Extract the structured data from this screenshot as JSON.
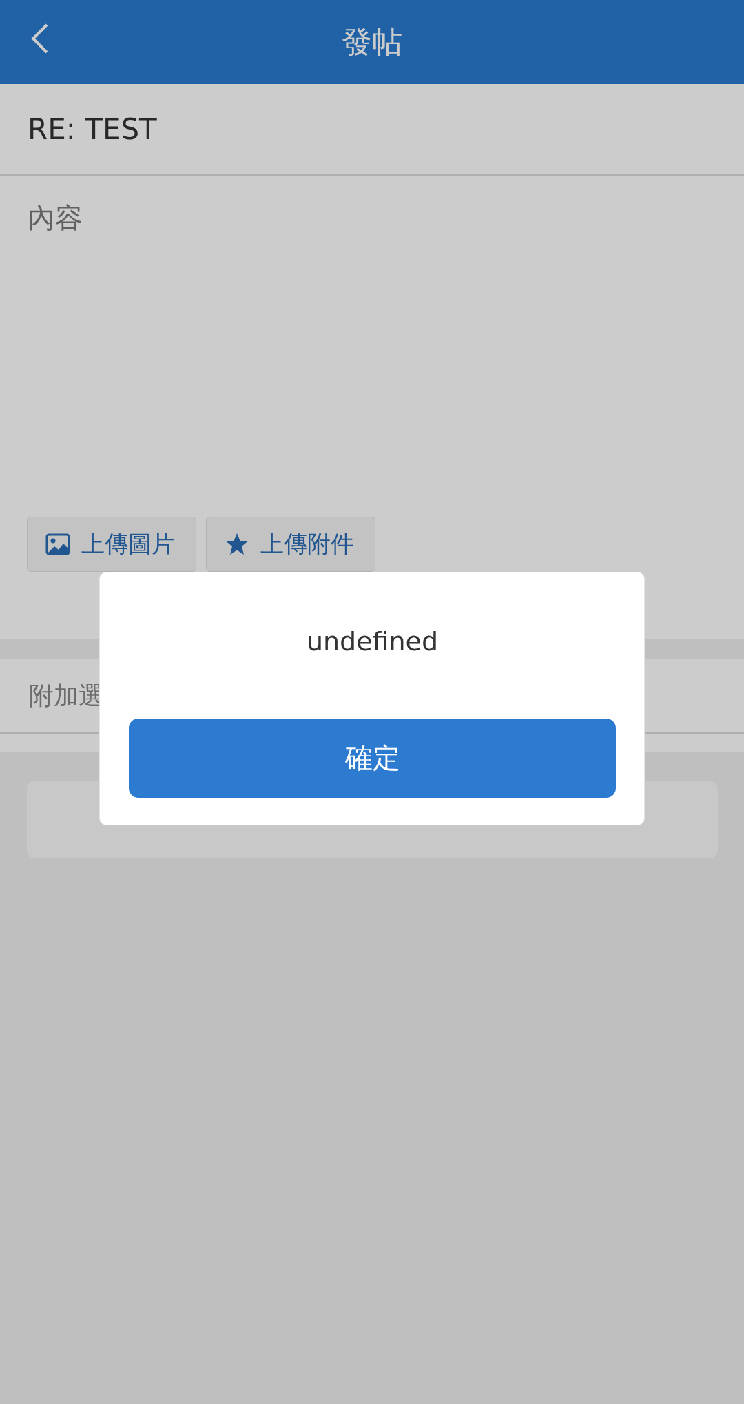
{
  "header": {
    "title": "發帖"
  },
  "subject": {
    "value": "RE: TEST"
  },
  "content": {
    "placeholder": "內容"
  },
  "upload_buttons": [
    {
      "label": "上傳圖片",
      "kind": "image"
    },
    {
      "label": "上傳附件",
      "kind": "attachment"
    }
  ],
  "options": {
    "label": "附加選"
  },
  "dialog": {
    "message": "undefined",
    "confirm_button": "確定"
  }
}
